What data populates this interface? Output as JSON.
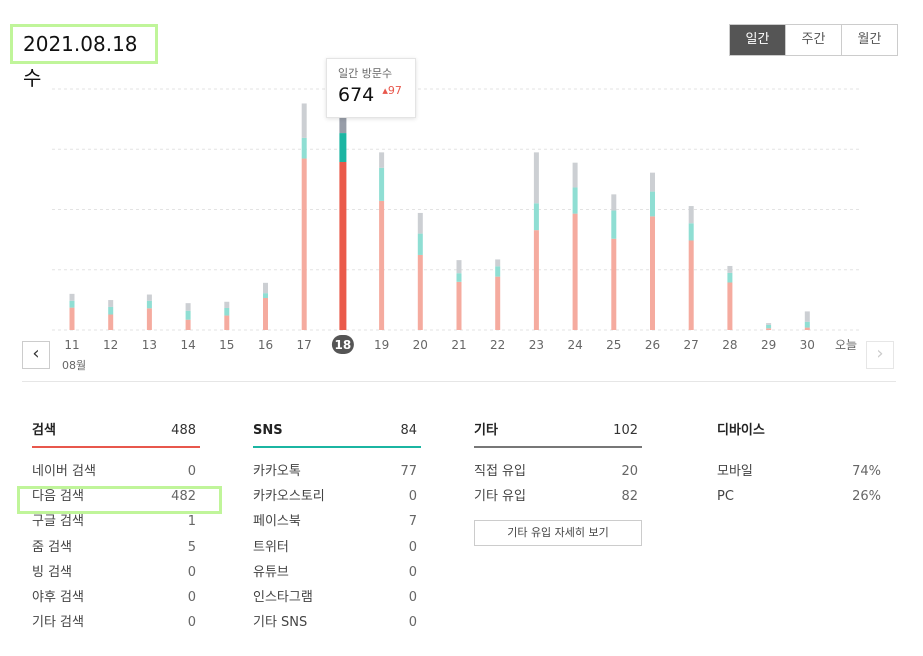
{
  "header": {
    "date": "2021.08.18 수",
    "period_tabs": [
      {
        "label": "일간",
        "active": true
      },
      {
        "label": "주간",
        "active": false
      },
      {
        "label": "월간",
        "active": false
      }
    ]
  },
  "tooltip": {
    "label": "일간 방문수",
    "value": "674",
    "delta": "97",
    "delta_color": "#e8574c"
  },
  "month_label": "08월",
  "chart_data": {
    "type": "bar",
    "stacked": true,
    "categories": [
      "11",
      "12",
      "13",
      "14",
      "15",
      "16",
      "17",
      "18",
      "19",
      "20",
      "21",
      "22",
      "23",
      "24",
      "25",
      "26",
      "27",
      "28",
      "29",
      "30",
      "오늘"
    ],
    "selected_category": "18",
    "series": [
      {
        "values": [
          65,
          45,
          63,
          30,
          42,
          93,
          498,
          488,
          375,
          218,
          140,
          155,
          290,
          338,
          265,
          330,
          260,
          138,
          5,
          7,
          0
        ],
        "color": "#f5ab9f",
        "selected_color": "#ea5a4a"
      },
      {
        "values": [
          20,
          22,
          22,
          26,
          22,
          14,
          60,
          84,
          96,
          62,
          25,
          30,
          78,
          76,
          82,
          72,
          50,
          28,
          10,
          17,
          0
        ],
        "color": "#8fded3",
        "selected_color": "#1bb5a2"
      },
      {
        "values": [
          20,
          20,
          18,
          22,
          18,
          30,
          100,
          102,
          45,
          60,
          38,
          20,
          148,
          72,
          47,
          55,
          50,
          20,
          5,
          30,
          0
        ],
        "color": "#cccfd3",
        "selected_color": "#979da8"
      }
    ],
    "ylim": [
      0,
      700
    ],
    "grid": true
  },
  "stats": {
    "search": {
      "title": "검색",
      "total": "488",
      "rows": [
        {
          "label": "네이버 검색",
          "value": "0"
        },
        {
          "label": "다음 검색",
          "value": "482"
        },
        {
          "label": "구글 검색",
          "value": "1"
        },
        {
          "label": "줌 검색",
          "value": "5"
        },
        {
          "label": "빙 검색",
          "value": "0"
        },
        {
          "label": "야후 검색",
          "value": "0"
        },
        {
          "label": "기타 검색",
          "value": "0"
        }
      ]
    },
    "sns": {
      "title": "SNS",
      "total": "84",
      "rows": [
        {
          "label": "카카오톡",
          "value": "77"
        },
        {
          "label": "카카오스토리",
          "value": "0"
        },
        {
          "label": "페이스북",
          "value": "7"
        },
        {
          "label": "트위터",
          "value": "0"
        },
        {
          "label": "유튜브",
          "value": "0"
        },
        {
          "label": "인스타그램",
          "value": "0"
        },
        {
          "label": "기타 SNS",
          "value": "0"
        }
      ]
    },
    "other": {
      "title": "기타",
      "total": "102",
      "rows": [
        {
          "label": "직접 유입",
          "value": "20"
        },
        {
          "label": "기타 유입",
          "value": "82"
        }
      ],
      "button": "기타 유입 자세히 보기"
    },
    "device": {
      "title": "디바이스",
      "rows": [
        {
          "label": "모바일",
          "value": "74%"
        },
        {
          "label": "PC",
          "value": "26%"
        }
      ]
    }
  },
  "colors": {
    "search_accent": "#e8574c",
    "sns_accent": "#1bb5a2",
    "other_accent": "#777777",
    "highlight": "#c0f59a"
  }
}
